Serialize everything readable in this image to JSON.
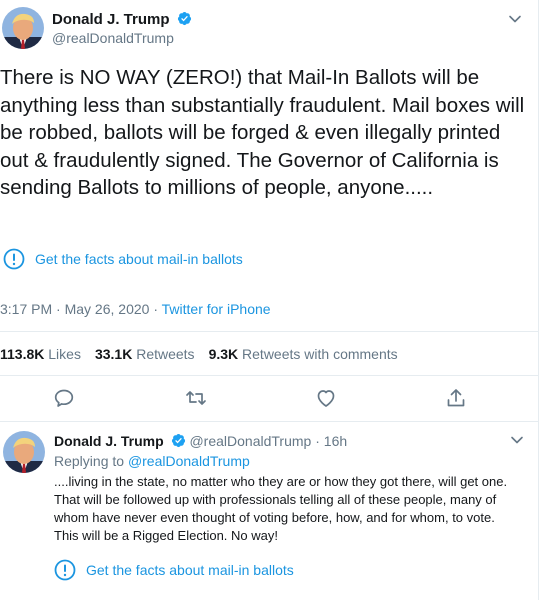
{
  "main_tweet": {
    "author_name": "Donald J. Trump",
    "handle": "@realDonaldTrump",
    "text": "There is NO WAY (ZERO!) that Mail-In Ballots will be anything less than substantially fraudulent. Mail boxes will be robbed, ballots will be forged & even illegally printed out & fraudulently signed. The Governor of California is sending Ballots to millions of people, anyone.....",
    "facts_label": "Get the facts about mail-in ballots",
    "time": "3:17 PM",
    "date": "May 26, 2020",
    "separator": "·",
    "source": "Twitter for iPhone",
    "stats": {
      "likes_count": "113.8K",
      "likes_label": "Likes",
      "retweets_count": "33.1K",
      "retweets_label": "Retweets",
      "comments_count": "9.3K",
      "comments_label": "Retweets with comments"
    },
    "icons": [
      "reply-icon",
      "retweet-icon",
      "like-icon",
      "share-icon"
    ]
  },
  "reply_tweet": {
    "author_name": "Donald J. Trump",
    "handle": "@realDonaldTrump",
    "separator": "·",
    "age": "16h",
    "replying_label": "Replying to",
    "replying_to": "@realDonaldTrump",
    "text": "....living in the state, no matter who they are or how they got there, will get one. That will be followed up with professionals telling all of these people, many of whom have never even thought of voting before, how, and for whom, to vote. This will be a Rigged Election. No way!",
    "facts_label": "Get the facts about mail-in ballots"
  },
  "colors": {
    "accent": "#1b95e0",
    "text": "#14171a",
    "muted": "#657786",
    "verified": "#1da1f2",
    "divider": "#e6ecf0"
  }
}
